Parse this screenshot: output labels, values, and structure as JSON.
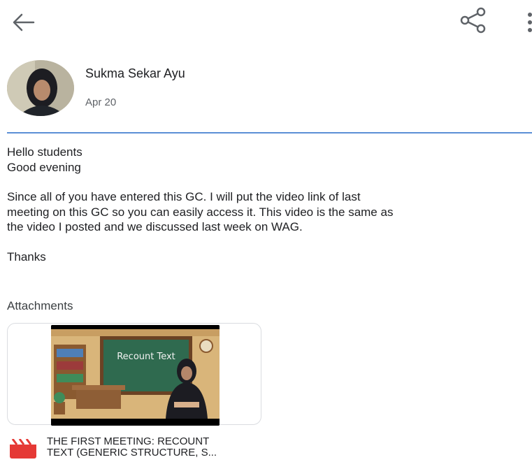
{
  "toolbar": {
    "back_icon": "arrow-left-icon",
    "share_icon": "share-icon",
    "more_icon": "more-vertical-icon"
  },
  "post": {
    "author": "Sukma Sekar Ayu",
    "date": "Apr 20",
    "lines": [
      "Hello students",
      "Good evening",
      "",
      "Since all of you have entered this GC.  I will put the video link of last",
      "meeting on this GC so you can easily access it.  This video is the same as",
      "the video I posted and we discussed last week on WAG.",
      "",
      "Thanks"
    ]
  },
  "attachments": {
    "label": "Attachments",
    "video": {
      "thumbnail_text": "Recount Text",
      "title_line1": "THE FIRST MEETING: RECOUNT",
      "title_line2": "TEXT (GENERIC STRUCTURE, S..."
    }
  },
  "colors": {
    "divider": "#5b8fd6",
    "video_icon": "#e53935",
    "chalkboard": "#2f6a4f"
  }
}
